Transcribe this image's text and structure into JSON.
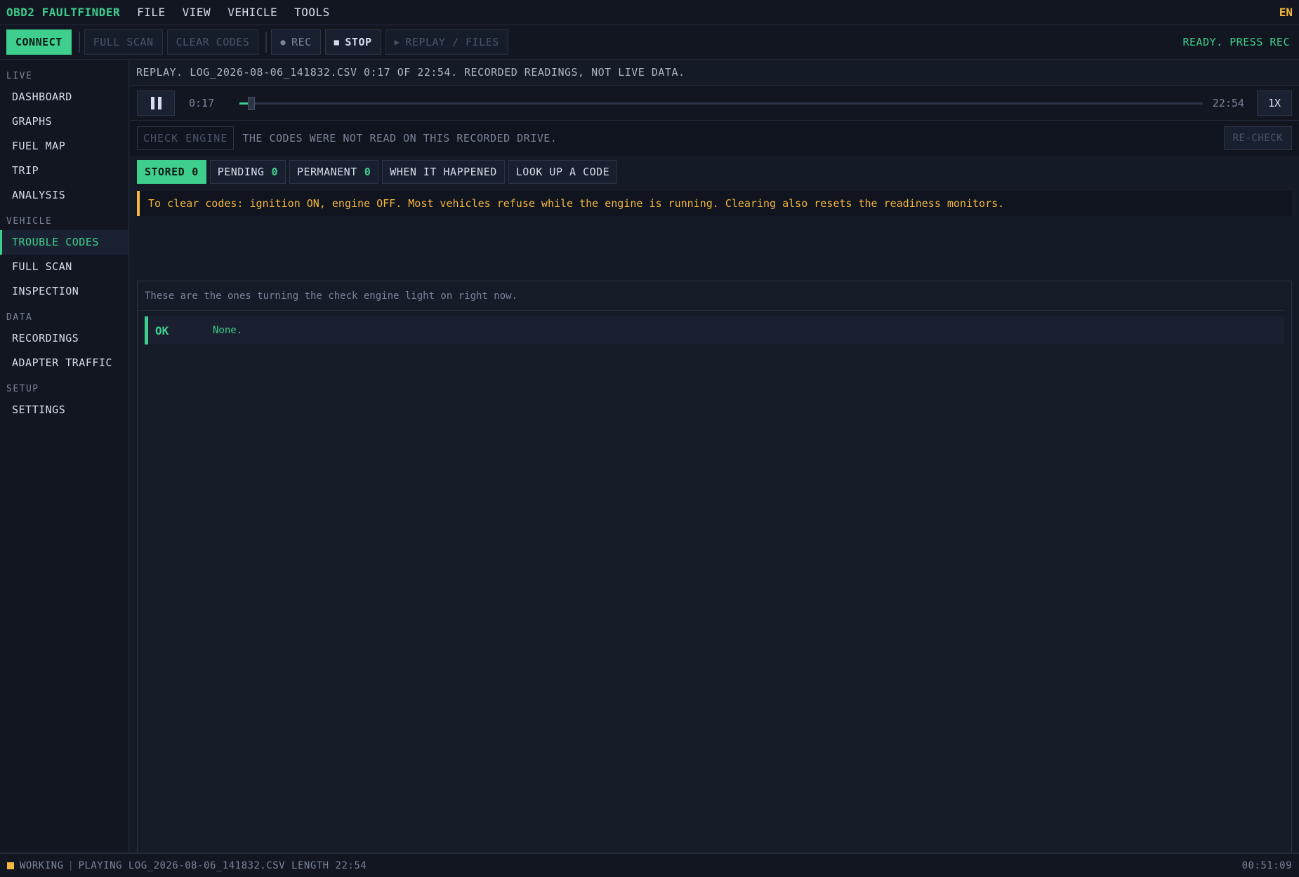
{
  "app": {
    "title": "OBD2 FAULTFINDER",
    "language": "EN"
  },
  "menu": [
    "FILE",
    "VIEW",
    "VEHICLE",
    "TOOLS"
  ],
  "toolbar": {
    "connect": "CONNECT",
    "full_scan": "FULL SCAN",
    "clear_codes": "CLEAR CODES",
    "rec": "REC",
    "stop": "STOP",
    "replay_files": "REPLAY / FILES",
    "status": "READY. PRESS REC"
  },
  "sidebar": {
    "sections": [
      {
        "label": "LIVE",
        "items": [
          "DASHBOARD",
          "GRAPHS",
          "FUEL MAP",
          "TRIP",
          "ANALYSIS"
        ]
      },
      {
        "label": "VEHICLE",
        "items": [
          "TROUBLE CODES",
          "FULL SCAN",
          "INSPECTION"
        ]
      },
      {
        "label": "DATA",
        "items": [
          "RECORDINGS",
          "ADAPTER TRAFFIC"
        ]
      },
      {
        "label": "SETUP",
        "items": [
          "SETTINGS"
        ]
      }
    ],
    "active": "TROUBLE CODES"
  },
  "replay": {
    "banner": "REPLAY. LOG_2026-08-06_141832.CSV 0:17 OF 22:54. RECORDED READINGS, NOT LIVE DATA.",
    "current": "0:17",
    "total": "22:54",
    "progress": 0.0124,
    "speed": "1X"
  },
  "check_engine": {
    "badge": "CHECK ENGINE",
    "text": "THE CODES WERE NOT READ ON THIS RECORDED DRIVE.",
    "recheck": "RE-CHECK"
  },
  "tabs": [
    {
      "label": "STORED",
      "count": "0",
      "active": true
    },
    {
      "label": "PENDING",
      "count": "0"
    },
    {
      "label": "PERMANENT",
      "count": "0"
    },
    {
      "label": "WHEN IT HAPPENED"
    },
    {
      "label": "LOOK UP A CODE"
    }
  ],
  "warning": {
    "prefix": "To clear codes:",
    "ign": "ignition ON,",
    "eng": "engine OFF.",
    "rest": "Most vehicles refuse while the engine is running. Clearing also resets the readiness monitors."
  },
  "panel": {
    "description": "These are the ones turning the check engine light on right now.",
    "status": "OK",
    "result": "None."
  },
  "statusbar": {
    "state": "WORKING",
    "info": "PLAYING LOG_2026-08-06_141832.CSV LENGTH 22:54",
    "clock": "00:51:09"
  },
  "colors": {
    "accent": "#3ecf8e",
    "warning": "#f5b83d",
    "background": "#141a26"
  }
}
